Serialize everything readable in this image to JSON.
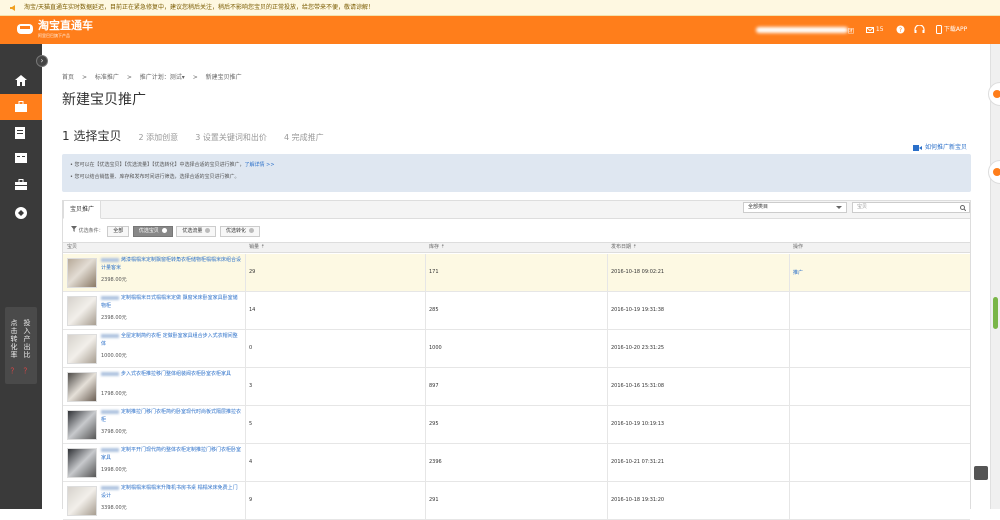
{
  "notice": {
    "text": "淘宝/天猫直通车实时数据延迟，目前正在紧急修复中，建议您稍后关注，稍后不影响您宝贝的正常投放，给您带来不便，敬请谅解！"
  },
  "header": {
    "logo_name": "淘宝直通车",
    "logo_slogan": "阿里巴巴旗下产品",
    "user_suffix": "团",
    "message_count": "15",
    "download_label": "下载APP"
  },
  "sidebar": {
    "items": [
      {
        "icon": "home-icon"
      },
      {
        "icon": "briefcase-icon",
        "active": true
      },
      {
        "icon": "report-icon"
      },
      {
        "icon": "account-icon"
      },
      {
        "icon": "toolbox-icon"
      },
      {
        "icon": "diamond-icon"
      }
    ],
    "promo_columns": [
      "点击转化率",
      "投入产出比"
    ],
    "promo_marks": [
      "？",
      "？"
    ]
  },
  "breadcrumb": [
    "首页",
    ">",
    "标准推广",
    ">",
    "推广计划：测试▾",
    ">",
    "新建宝贝推广"
  ],
  "page_title": "新建宝贝推广",
  "steps": [
    {
      "label": "1 选择宝贝",
      "active": true
    },
    {
      "label": "2 添加创意",
      "active": false
    },
    {
      "label": "3 设置关键词和出价",
      "active": false
    },
    {
      "label": "4 完成推广",
      "active": false
    }
  ],
  "help_link": "如何推广新宝贝",
  "tips": {
    "line1_prefix": "• 您可以在【优选宝贝】【优选流量】【优选转化】中选择合适的宝贝进行推广，",
    "line1_link": "了解详情 >>",
    "line2": "• 您可以结合销售量、库存和发布时间进行筛选，选择合适的宝贝进行推广。"
  },
  "panel": {
    "tab_label": "宝贝推广",
    "category_select": "全部类目",
    "search_placeholder": "宝贝",
    "filter_label": "优选条件：",
    "filters": [
      {
        "label": "全部",
        "active": false,
        "badge": false
      },
      {
        "label": "优选宝贝",
        "active": true,
        "badge": true
      },
      {
        "label": "优选流量",
        "active": false,
        "badge": true
      },
      {
        "label": "优选转化",
        "active": false,
        "badge": true
      }
    ]
  },
  "table": {
    "columns": [
      "宝贝",
      "销量 ⇡",
      "库存 ⇡",
      "发布日期 ⇡",
      "操作"
    ],
    "rows": [
      {
        "name": "烤漆榻榻米定制飘窗柜转角衣柜储物柜榻榻米床组合设计量客米",
        "price": "2398.00元",
        "sales": "29",
        "stock": "171",
        "date": "2016-10-18 09:02:21",
        "action": "推广",
        "highlight": true
      },
      {
        "name": "定制榻榻米日式榻榻米定做 飘窗米床卧室家具卧室储物柜",
        "price": "2398.00元",
        "sales": "14",
        "stock": "285",
        "date": "2016-10-19 19:31:38",
        "action": "",
        "highlight": false
      },
      {
        "name": "全屋定制简约衣柜 定做卧室家具组合步入式衣帽间整体",
        "price": "1000.00元",
        "sales": "0",
        "stock": "1000",
        "date": "2016-10-20 23:31:25",
        "action": "",
        "highlight": false
      },
      {
        "name": "步入式衣柜推拉移门整体组装阀衣柜卧室衣柜家具",
        "price": "1798.00元",
        "sales": "3",
        "stock": "897",
        "date": "2016-10-16 15:31:08",
        "action": "",
        "highlight": false
      },
      {
        "name": "定制推拉门移门衣柜简约卧室现代时尚板式隔层推拉衣柜",
        "price": "3798.00元",
        "sales": "5",
        "stock": "295",
        "date": "2016-10-19 10:19:13",
        "action": "",
        "highlight": false
      },
      {
        "name": "定制平开门现代简约整体衣柜定制推拉门移门衣柜卧室家具",
        "price": "1998.00元",
        "sales": "4",
        "stock": "2396",
        "date": "2016-10-21 07:31:21",
        "action": "",
        "highlight": false
      },
      {
        "name": "定制榻榻米榻榻米升降机书房书桌 榻榻米床免费上门设计",
        "price": "3398.00元",
        "sales": "9",
        "stock": "291",
        "date": "2016-10-18 19:31:20",
        "action": "",
        "highlight": false
      }
    ]
  },
  "colors": {
    "brand": "#ff7e1b",
    "sidebar": "#3a3a3a",
    "link": "#2a6fc9",
    "tip_bg": "#dfe7f1"
  }
}
